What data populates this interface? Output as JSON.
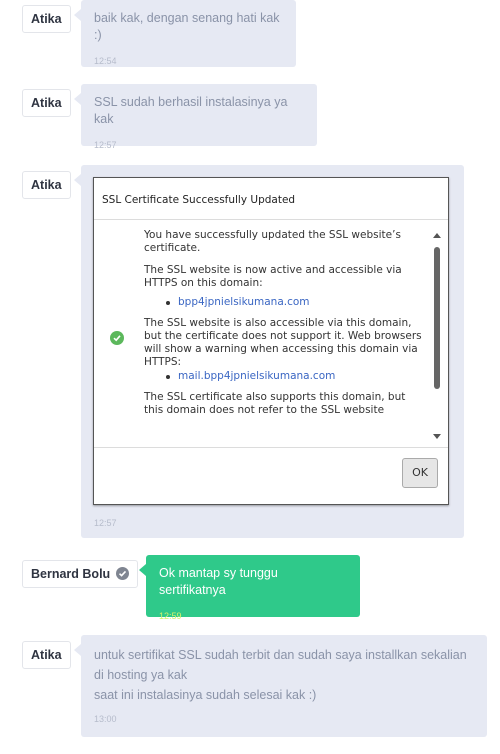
{
  "messages": [
    {
      "sender": "Atika",
      "text": "baik kak, dengan senang hati kak :)",
      "time": "12:54"
    },
    {
      "sender": "Atika",
      "text": "SSL sudah berhasil instalasinya ya kak",
      "time": "12:57"
    },
    {
      "sender": "Atika",
      "time": "12:57",
      "screenshot": {
        "title": "SSL Certificate Successfully Updated",
        "p1": "You have successfully updated the SSL website’s certificate.",
        "p2": "The SSL website is now active and accessible via HTTPS on this domain:",
        "domain1": "bpp4jpnielsikumana.com",
        "p3": "The SSL website is also accessible via this domain, but the certificate does not support it. Web browsers will show a warning when accessing this domain via HTTPS:",
        "domain2": "mail.bpp4jpnielsikumana.com",
        "p4": "The SSL certificate also supports this domain, but this domain does not refer to the SSL website",
        "ok_label": "OK"
      }
    },
    {
      "sender": "Bernard Bolu",
      "verified": true,
      "text": "Ok mantap sy tunggu sertifikatnya",
      "time": "12:59"
    },
    {
      "sender": "Atika",
      "lines": [
        "untuk sertifikat SSL sudah terbit dan sudah saya installkan sekalian di hosting ya kak",
        "saat ini instalasinya sudah selesai kak :)"
      ],
      "time": "13:00"
    }
  ],
  "colors": {
    "bubble_other": "#e6e9f3",
    "bubble_self": "#2fc98a",
    "self_time": "#d6f26b",
    "link": "#3a66c3",
    "check": "#5cb85c"
  },
  "icons": {
    "verified": "verified-check-icon",
    "success": "success-check-icon"
  }
}
